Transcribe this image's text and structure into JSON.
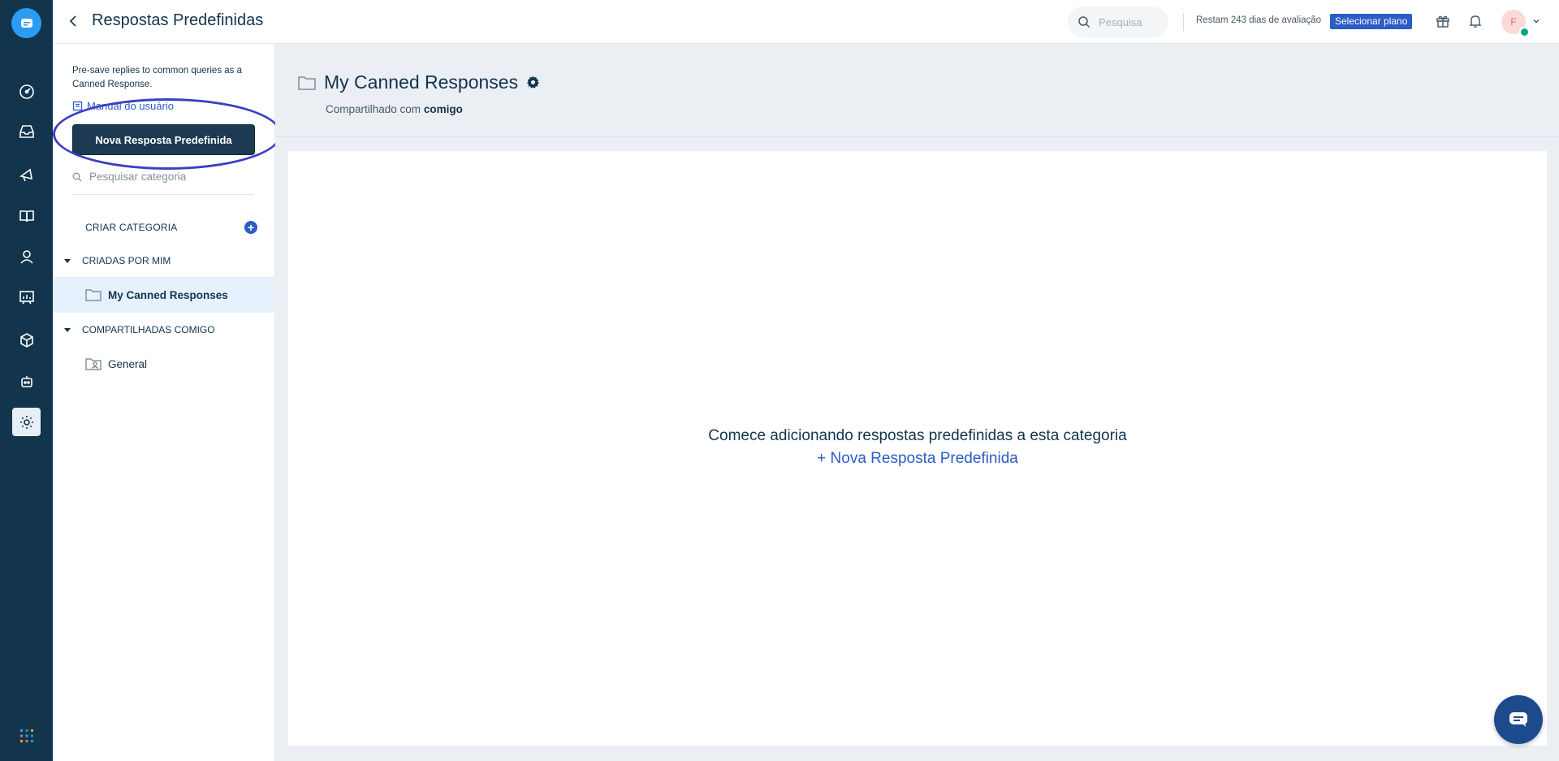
{
  "header": {
    "title": "Respostas Predefinidas",
    "search_placeholder": "Pesquisa",
    "trial_text": "Restam 243 dias de avaliação",
    "plan_button": "Selecionar plano",
    "avatar_initial": "F"
  },
  "nav": {
    "items": [
      "dashboard-icon",
      "inbox-icon",
      "campaigns-icon",
      "knowledge-base-icon",
      "contacts-icon",
      "reports-icon",
      "marketplace-icon",
      "bot-icon",
      "settings-icon"
    ],
    "active": "settings-icon"
  },
  "sidebar": {
    "description": "Pre-save replies to common queries as a Canned Response.",
    "manual_link": "Manual do usuário",
    "new_button": "Nova Resposta Predefinida",
    "search_placeholder": "Pesquisar categoria",
    "create_category": "CRIAR CATEGORIA",
    "groups": [
      {
        "label": "CRIADAS POR MIM",
        "items": [
          {
            "label": "My Canned Responses",
            "active": true
          }
        ]
      },
      {
        "label": "COMPARTILHADAS COMIGO",
        "items": [
          {
            "label": "General",
            "active": false
          }
        ]
      }
    ]
  },
  "main": {
    "folder_title": "My Canned Responses",
    "shared_prefix": "Compartilhado com",
    "shared_with": "comigo",
    "empty_message": "Comece adicionando respostas predefinidas a esta categoria",
    "empty_link": "+ Nova Resposta Predefinida"
  },
  "colors": {
    "rail": "#12344d",
    "accent": "#2c5cc5",
    "primary_button": "#1e3a52",
    "annotation": "#3b3fc2"
  }
}
